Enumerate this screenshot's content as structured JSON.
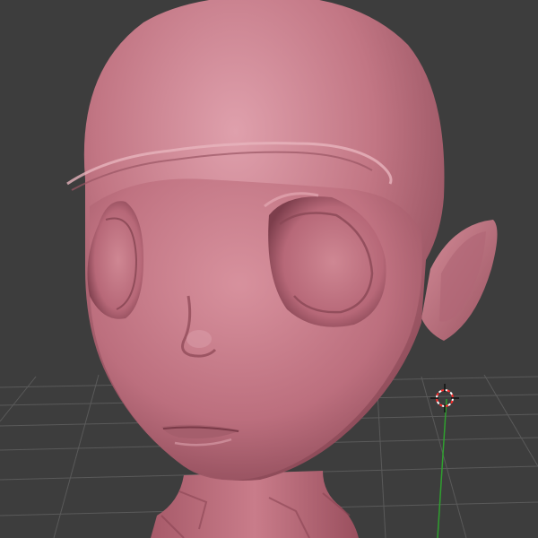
{
  "app": {
    "view": "3d-viewport",
    "background_color": "#3d3d3d",
    "grid_color": "#5a5a5a",
    "axis_y_color": "#2fa02f"
  },
  "model": {
    "icon": "sculpt-head-model",
    "skin_color": "#c77a88",
    "shadow_color": "#8c4a58",
    "highlight_color": "#e0a0ad"
  },
  "cursor": {
    "icon": "3d-cursor-icon",
    "ring_colors": [
      "#ffffff",
      "#ff2a2a"
    ]
  }
}
